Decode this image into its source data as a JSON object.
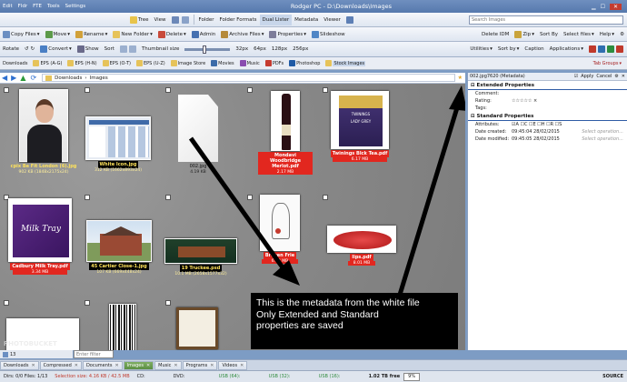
{
  "titlebar": {
    "menu": [
      "Edit",
      "Fldr",
      "FTE",
      "Tools",
      "Settings"
    ],
    "title": "Rodger PC - D:\\Downloads\\Images"
  },
  "toolbar1": {
    "tree": "Tree",
    "view": "View",
    "folder": "Folder",
    "folder_formats": "Folder Formats",
    "dual_lister": "Dual Lister",
    "metadata": "Metadata",
    "viewer": "Viewer",
    "search_placeholder": "Search Images"
  },
  "toolbar2": {
    "copy": "Copy Files",
    "move": "Move",
    "rename": "Rename",
    "new_folder": "New Folder",
    "delete": "Delete",
    "admin": "Admin",
    "archive": "Archive Files",
    "properties": "Properties",
    "slideshow": "Slideshow",
    "delete_idm": "Delete IDM",
    "zip": "Zip",
    "sort_by": "Sort By",
    "select_files": "Select files",
    "help": "Help"
  },
  "toolbar3": {
    "rotate": "Rotate",
    "convert": "Convert",
    "show": "Show",
    "sort": "Sort",
    "thumb_label": "Thumbnail size",
    "s32": "32px",
    "s64": "64px",
    "s128": "128px",
    "s256": "256px",
    "utilities": "Utilities",
    "sortby": "Sort by",
    "caption": "Caption",
    "applications": "Applications"
  },
  "links": {
    "items": [
      "Downloads",
      "EPS (A-G)",
      "EPS (H-N)",
      "EPS (O-T)",
      "EPS (U-Z)",
      "Image Store",
      "Movies",
      "Music",
      "PDFs",
      "Photoshop",
      "Stock Images"
    ],
    "tab_groups": "Tab Groups"
  },
  "nav": {
    "path1": "Downloads",
    "path2": "Images"
  },
  "thumbs": [
    {
      "cap": "cpix Be Fit London (6).jpg",
      "sub": "902 KB (1848x2175x24)",
      "style": "yel"
    },
    {
      "cap": "White Icon.jpg",
      "sub": "312 KB (1662x893x24)",
      "style": "yel"
    },
    {
      "cap": "002.jpg",
      "sub": "4.19 KB",
      "style": "plain"
    },
    {
      "cap": "Mondavi Woodbridge Merlot.pdf",
      "sub": "2.17 MB",
      "style": "red"
    },
    {
      "cap": "Twinings Blck Tea.pdf",
      "sub": "6.17 MB",
      "style": "red"
    },
    {
      "cap": "Cadbury Milk Tray.pdf",
      "sub": "3.34 MB",
      "style": "red"
    },
    {
      "cap": "45 Cartier Close-1.jpg",
      "sub": "107 KB (669x448x24)",
      "style": "yel"
    },
    {
      "cap": "19 Truckee.psd",
      "sub": "10.1 MB (2658x1577x32)",
      "style": "yel"
    },
    {
      "cap": "Broken Frie",
      "sub": "6.74 MB",
      "style": "red"
    },
    {
      "cap": "lips.pdf",
      "sub": "8.01 MB",
      "style": "red"
    }
  ],
  "twinings": {
    "brand": "TWININGS",
    "product": "LADY GREY"
  },
  "milktray": {
    "brand": "Milk Tray"
  },
  "metadata": {
    "tab": "002.jpg7620 (Metadata)",
    "apply": "Apply",
    "cancel": "Cancel",
    "gear": "",
    "ext_title": "Extended Properties",
    "ext": [
      {
        "k": "Comment:",
        "v": ""
      },
      {
        "k": "Rating:",
        "v": "☆☆☆☆☆  ×"
      },
      {
        "k": "Tags:",
        "v": ""
      }
    ],
    "std_title": "Standard Properties",
    "attributes_label": "Attributes:",
    "attributes": "☑A ☐C ☐E ☐H ☐R ☐S",
    "std": [
      {
        "k": "Date created:",
        "v": "09:45:04   28/02/2015",
        "h": "Select operation..."
      },
      {
        "k": "Date modified:",
        "v": "09:45:05   28/02/2015",
        "h": "Select operation..."
      }
    ]
  },
  "annotation": {
    "l1": "This is the metadata from the white file",
    "l2": "Only Extended and Standard",
    "l3": "properties are saved"
  },
  "tabs": [
    {
      "label": "Downloads",
      "active": false
    },
    {
      "label": "Compressed",
      "active": false
    },
    {
      "label": "Documents",
      "active": false
    },
    {
      "label": "Images",
      "active": true
    },
    {
      "label": "Music",
      "active": false
    },
    {
      "label": "Programs",
      "active": false
    },
    {
      "label": "Videos",
      "active": false
    }
  ],
  "bottom": {
    "pages": "13",
    "filter_placeholder": "Enter filter"
  },
  "status": {
    "dirs": "Dirs: 0/0  Files: 1/13",
    "selection": "Selection size: 4.16 KB / 42.5 MB",
    "cd": "CD:",
    "dvd": "DVD:",
    "usb64": "USB (64):",
    "usb32": "USB (32):",
    "usb16": "USB (16):",
    "size": "1.02 TB free",
    "pct": "9%",
    "source": "SOURCE"
  },
  "watermark": "PHOTOBUCKET"
}
